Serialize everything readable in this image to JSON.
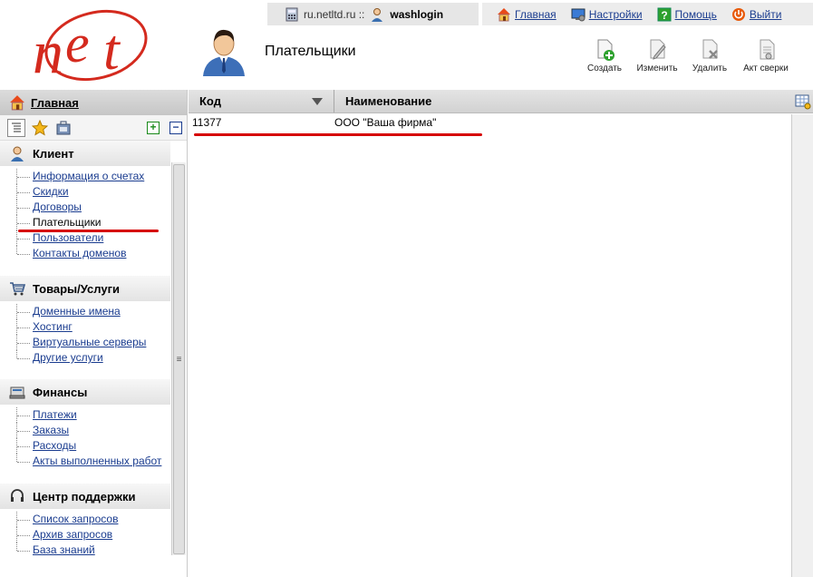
{
  "header": {
    "server": "ru.netltd.ru ::",
    "login": "washlogin",
    "links": [
      {
        "label": "Главная",
        "icon": "home-icon"
      },
      {
        "label": "Настройки",
        "icon": "settings-monitor-icon"
      },
      {
        "label": "Помощь",
        "icon": "help-icon"
      },
      {
        "label": "Выйти",
        "icon": "power-icon"
      }
    ],
    "page_title": "Плательщики"
  },
  "toolbar": {
    "create": "Создать",
    "edit": "Изменить",
    "delete": "Удалить",
    "reconcile": "Акт сверки"
  },
  "sidebar": {
    "home": "Главная",
    "sections": [
      {
        "title": "Клиент",
        "items": [
          "Информация о счетах",
          "Скидки",
          "Договоры",
          "Плательщики",
          "Пользователи",
          "Контакты доменов"
        ]
      },
      {
        "title": "Товары/Услуги",
        "items": [
          "Доменные имена",
          "Хостинг",
          "Виртуальные серверы",
          "Другие услуги"
        ]
      },
      {
        "title": "Финансы",
        "items": [
          "Платежи",
          "Заказы",
          "Расходы",
          "Акты выполненных работ"
        ]
      },
      {
        "title": "Центр поддержки",
        "items": [
          "Список запросов",
          "Архив запросов",
          "База знаний"
        ]
      }
    ]
  },
  "grid": {
    "col_code": "Код",
    "col_name": "Наименование",
    "rows": [
      {
        "code": "11377",
        "name": "ООО \"Ваша фирма\""
      }
    ]
  },
  "colors": {
    "link": "#1a3c8f",
    "highlight": "#d60000",
    "logo_red": "#d42a1e"
  }
}
